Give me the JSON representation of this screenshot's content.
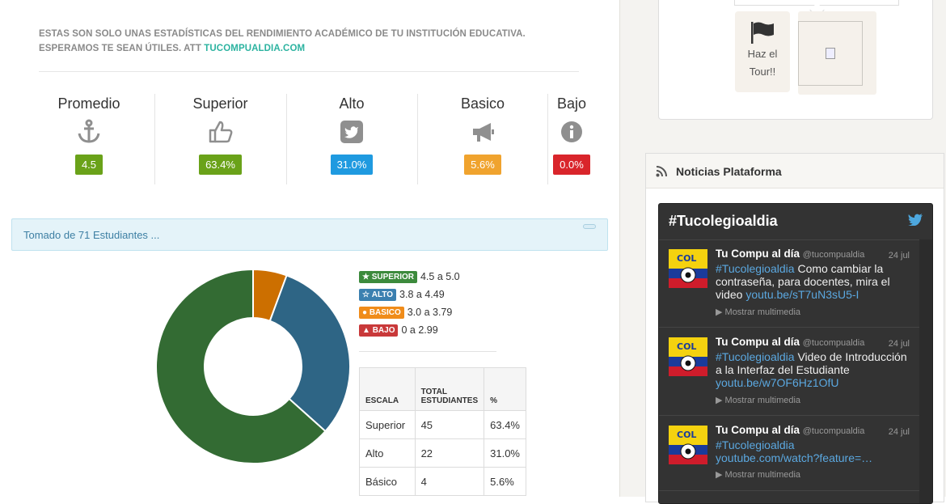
{
  "intro": {
    "text": "ESTAS SON SOLO UNAS ESTADÍSTICAS DEL RENDIMIENTO ACADÉMICO DE TU INSTITUCIÓN EDUCATIVA. ESPERAMOS TE SEAN ÚTILES. ATT",
    "link": "TUCOMPUALDIA.COM"
  },
  "stats": [
    {
      "title": "Promedio",
      "value": "4.5",
      "icon": "anchor-icon",
      "color": "#6aa219"
    },
    {
      "title": "Superior",
      "value": "63.4%",
      "icon": "thumbs-up-icon",
      "color": "#6aa219"
    },
    {
      "title": "Alto",
      "value": "31.0%",
      "icon": "twitter-square-icon",
      "color": "#1f9ae0"
    },
    {
      "title": "Basico",
      "value": "5.6%",
      "icon": "bullhorn-icon",
      "color": "#f0a32e"
    },
    {
      "title": "Bajo",
      "value": "0.0%",
      "icon": "info-circle-icon",
      "color": "#d9252b"
    }
  ],
  "alert": {
    "text": "Tomado de 71 Estudiantes ..."
  },
  "legend": [
    {
      "label": "SUPERIOR",
      "range": "4.5 a 5.0",
      "color": "#3c8a3c",
      "icon": "star-icon"
    },
    {
      "label": "ALTO",
      "range": "3.8 a 4.49",
      "color": "#3b80b0",
      "icon": "star-outline-icon"
    },
    {
      "label": "BASICO",
      "range": "3.0 a 3.79",
      "color": "#f08c1a",
      "icon": "exclamation-circle-icon"
    },
    {
      "label": "BAJO",
      "range": "0 a 2.99",
      "color": "#c9393a",
      "icon": "warning-icon"
    }
  ],
  "table": {
    "headers": [
      "ESCALA",
      "TOTAL ESTUDIANTES",
      "%"
    ],
    "rows": [
      [
        "Superior",
        "45",
        "63.4%"
      ],
      [
        "Alto",
        "22",
        "31.0%"
      ],
      [
        "Básico",
        "4",
        "5.6%"
      ]
    ]
  },
  "chart_data": {
    "type": "pie",
    "donut": true,
    "categories": [
      "Superior",
      "Alto",
      "Básico",
      "Bajo"
    ],
    "values": [
      45,
      22,
      4,
      0
    ],
    "colors": [
      "#336b33",
      "#2e6585",
      "#cc6f00",
      "#c9393a"
    ]
  },
  "tour": {
    "label": "Haz el Tour!!"
  },
  "panel": {
    "title": "Noticias Plataforma"
  },
  "twitter": {
    "title": "#Tucolegioaldia",
    "tweets": [
      {
        "name": "Tu Compu al día",
        "handle": "@tucompualdia",
        "date": "24 jul",
        "hashtag": "#Tucolegioaldia",
        "text": " Como cambiar la contraseña, para docentes, mira el video ",
        "link": "youtu.be/sT7uN3sU5-I",
        "media": "Mostrar multimedia"
      },
      {
        "name": "Tu Compu al día",
        "handle": "@tucompualdia",
        "date": "24 jul",
        "hashtag": "#Tucolegioaldia",
        "text": " Video de Introducción a la Interfaz del Estudiante ",
        "link": "youtu.be/w7OF6Hz1OfU",
        "media": "Mostrar multimedia"
      },
      {
        "name": "Tu Compu al día",
        "handle": "@tucompualdia",
        "date": "24 jul",
        "hashtag": "#Tucolegioaldia",
        "text": "",
        "link": " youtube.com/watch?feature=…",
        "media": "Mostrar multimedia"
      }
    ]
  }
}
